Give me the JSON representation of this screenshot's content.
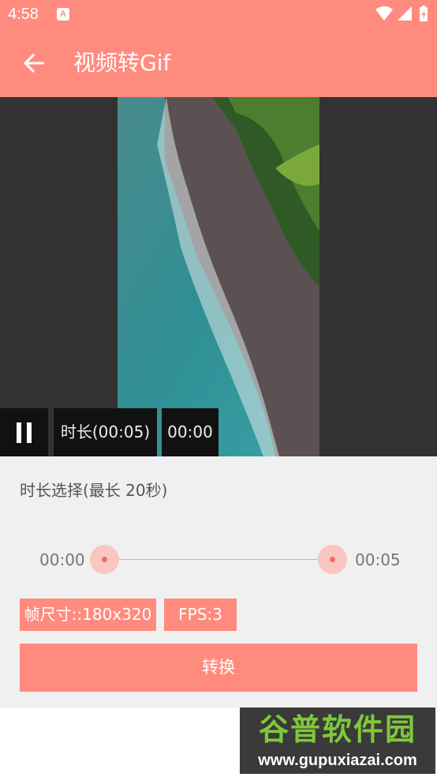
{
  "status_bar": {
    "time": "4:58",
    "notification_icon": "A",
    "icons": [
      "wifi-icon",
      "signal-icon",
      "battery-icon"
    ]
  },
  "app_bar": {
    "title": "视频转Gif",
    "back_icon": "arrow-back-icon"
  },
  "video": {
    "pause_icon": "pause-icon",
    "duration_label": "时长(00:05)",
    "current_time": "00:00"
  },
  "range": {
    "label": "时长选择(最长 20秒)",
    "start": "00:00",
    "end": "00:05"
  },
  "options": {
    "frame_size": "帧尺寸::180x320",
    "fps": "FPS:3"
  },
  "convert_button": "转换",
  "watermark": {
    "title": "谷普软件园",
    "url": "www.gupuxiazai.com"
  },
  "colors": {
    "accent": "#FF8B7E",
    "panel_bg": "#F0F0F0",
    "video_bg": "#323232",
    "thumb_fill": "#F9C6C0",
    "thumb_dot": "#F26A5F"
  }
}
